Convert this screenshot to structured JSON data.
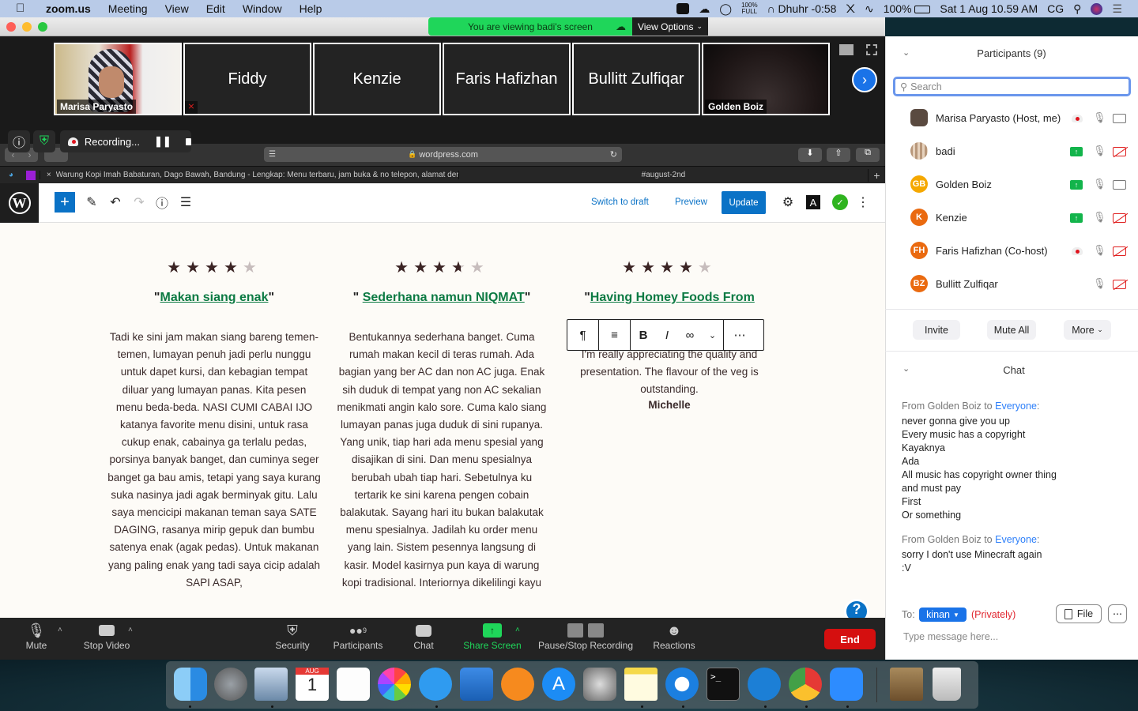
{
  "menubar": {
    "app": "zoom.us",
    "items": [
      "Meeting",
      "View",
      "Edit",
      "Window",
      "Help"
    ],
    "battery_small": [
      "100%",
      "FULL"
    ],
    "prayer": "Dhuhr -0:58",
    "battery": "100%",
    "datetime": "Sat 1 Aug  10.59 AM",
    "user": "CG"
  },
  "banner": {
    "viewing": "You are viewing badi's screen",
    "view_options": "View Options"
  },
  "gallery": {
    "tiles": [
      {
        "name": "Marisa Paryasto",
        "type": "video"
      },
      {
        "name": "Fiddy",
        "type": "name"
      },
      {
        "name": "Kenzie",
        "type": "name"
      },
      {
        "name": "Faris Hafizhan",
        "type": "name"
      },
      {
        "name": "Bullitt Zulfiqar",
        "type": "name"
      },
      {
        "name": "Golden Boiz",
        "type": "video"
      }
    ]
  },
  "recording": {
    "label": "Recording..."
  },
  "safari": {
    "url": "wordpress.com",
    "tabs": [
      {
        "title": "Warung Kopi Imah Babaturan, Dago Bawah, Bandung - Lengkap: Menu terbaru, jam buka & no telepon, alamat denga..."
      },
      {
        "title": "#august-2nd"
      }
    ]
  },
  "wp_toolbar": {
    "switch_to_draft": "Switch to draft",
    "preview": "Preview",
    "update": "Update"
  },
  "reviews": [
    {
      "rating": 4,
      "max": 5,
      "title_open": "\"",
      "title": "Makan siang enak",
      "title_close": "\"",
      "body": "Tadi ke sini jam makan siang bareng temen-temen, lumayan penuh jadi perlu nunggu untuk dapet kursi, dan kebagian tempat diluar yang lumayan panas. Kita pesen menu beda-beda. NASI CUMI CABAI IJO katanya favorite menu disini, untuk rasa cukup enak, cabainya ga terlalu pedas, porsinya banyak banget, dan cuminya seger banget ga bau amis, tetapi yang saya kurang suka nasinya jadi agak berminyak gitu. Lalu saya mencicipi makanan teman saya SATE DAGING, rasanya mirip gepuk dan bumbu satenya enak (agak pedas). Untuk makanan yang paling enak yang tadi saya cicip adalah SAPI ASAP,"
    },
    {
      "rating": 3.5,
      "max": 5,
      "title_open": "\" ",
      "title": "Sederhana namun NIQMAT",
      "title_close": "\"",
      "body": "Bentukannya sederhana banget. Cuma rumah makan kecil di teras rumah. Ada bagian yang ber AC dan non AC juga. Enak sih duduk di tempat yang non AC sekalian menikmati angin kalo sore. Cuma kalo siang lumayan panas juga duduk di sini rupanya. Yang unik, tiap hari ada menu spesial yang disajikan di sini. Dan menu spesialnya berubah ubah tiap hari. Sebetulnya ku tertarik ke sini karena pengen cobain balakutak. Sayang hari itu bukan balakutak menu spesialnya. Jadilah ku order menu yang lain. Sistem pesennya langsung di kasir. Model kasirnya pun kaya di warung kopi tradisional. Interiornya dikelilingi kayu"
    },
    {
      "rating": 4,
      "max": 5,
      "title_open": "\"",
      "title": "Having Homey Foods From ",
      "title_close": "",
      "body": "I'm really appreciating the quality and presentation. The flavour of the veg is outstanding.",
      "author": "Michelle"
    }
  ],
  "block_toolbar": [
    "paragraph",
    "align",
    "bold",
    "italic",
    "link",
    "more-options",
    "ellipsis"
  ],
  "zoom_toolbar": {
    "mute": "Mute",
    "stop_video": "Stop Video",
    "security": "Security",
    "participants": "Participants",
    "participants_count": "9",
    "chat": "Chat",
    "share_screen": "Share Screen",
    "pause_stop_recording": "Pause/Stop Recording",
    "reactions": "Reactions",
    "end": "End"
  },
  "participants_panel": {
    "title": "Participants (9)",
    "search_placeholder": "Search",
    "list": [
      {
        "name": "Marisa Paryasto (Host, me)",
        "initials": "",
        "color": "#5a4a40",
        "sharing": false,
        "recording": true,
        "video_off": false
      },
      {
        "name": "badi",
        "initials": "",
        "color": "#c9a98a",
        "sharing": true,
        "recording": false,
        "video_off": true
      },
      {
        "name": "Golden Boiz",
        "initials": "GB",
        "color": "#f5a800",
        "sharing": true,
        "recording": false,
        "video_off": false
      },
      {
        "name": "Kenzie",
        "initials": "K",
        "color": "#ea6a10",
        "sharing": true,
        "recording": false,
        "video_off": true
      },
      {
        "name": "Faris Hafizhan (Co-host)",
        "initials": "FH",
        "color": "#ea6a10",
        "sharing": false,
        "recording": true,
        "video_off": true
      },
      {
        "name": "Bullitt Zulfiqar",
        "initials": "BZ",
        "color": "#ea6a10",
        "sharing": false,
        "recording": false,
        "video_off": true
      }
    ],
    "invite": "Invite",
    "mute_all": "Mute All",
    "more": "More"
  },
  "chat": {
    "title": "Chat",
    "messages": [
      {
        "from": "From Golden Boiz to ",
        "to": "Everyone",
        "lines": [
          "never gonna give you up",
          "Every music has a copyright",
          "Kayaknya",
          "Ada",
          "All music has copyright owner thing",
          "and must pay",
          "First",
          "Or something"
        ]
      },
      {
        "from": "From Golden Boiz to ",
        "to": "Everyone",
        "lines": [
          "sorry I don't use Minecraft again",
          ":V"
        ]
      }
    ],
    "to_label": "To:",
    "recipient": "kinan",
    "privately": "(Privately)",
    "file": "File",
    "input_placeholder": "Type message here..."
  },
  "dock": {
    "apps": [
      "Finder",
      "Launchpad",
      "Preview",
      "Calendar",
      "Reminders",
      "Photos",
      "Messages",
      "Keynote",
      "Books",
      "App Store",
      "System Preferences",
      "Notes",
      "Safari",
      "Terminal",
      "Mountain Duck",
      "Chrome",
      "Zoom",
      "Archive",
      "Trash"
    ],
    "calendar_month": "AUG",
    "calendar_day": "1"
  }
}
